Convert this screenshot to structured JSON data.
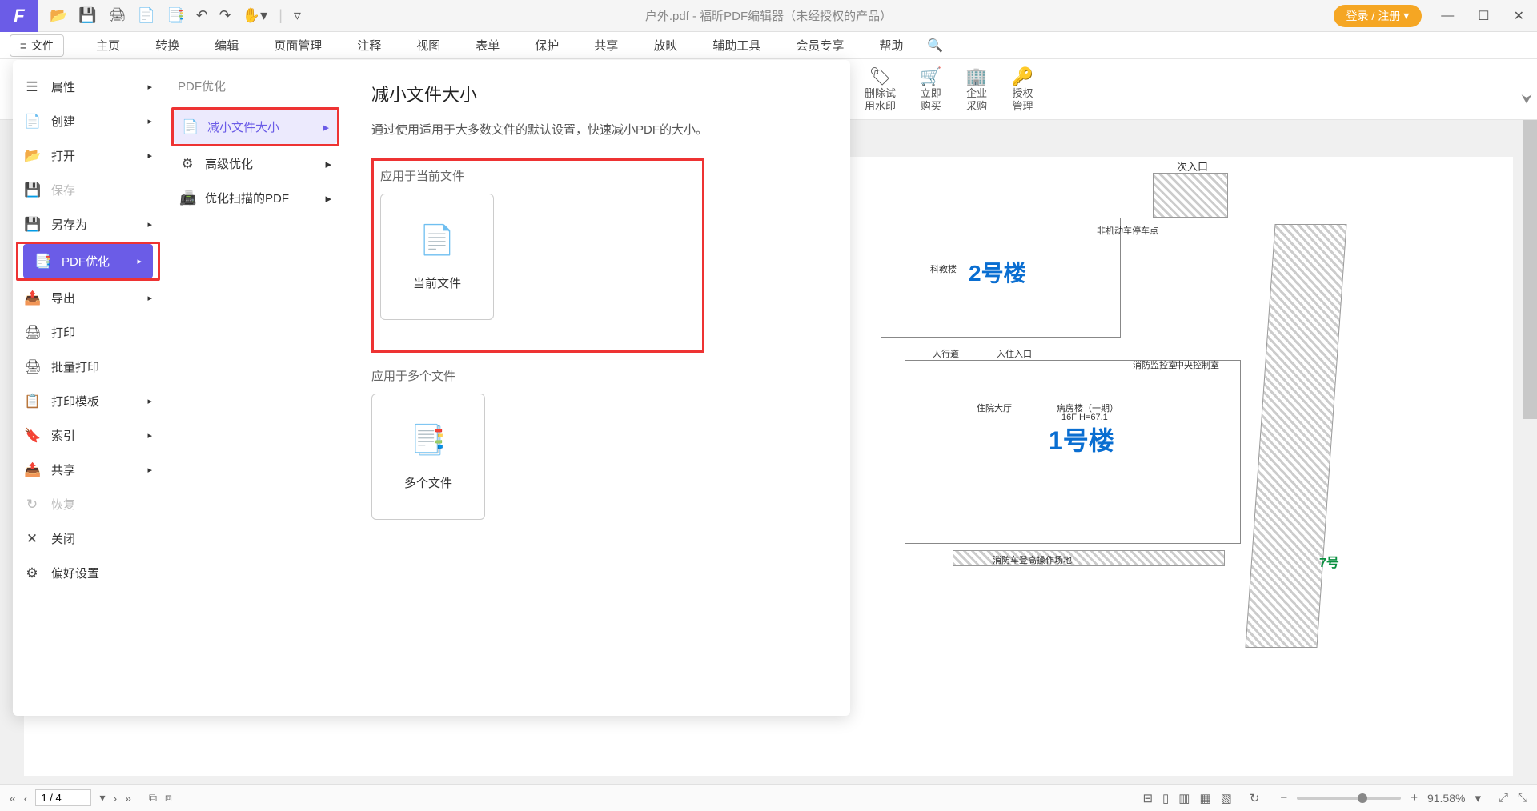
{
  "titlebar": {
    "title": "户外.pdf - 福昕PDF编辑器（未经授权的产品）",
    "login": "登录 / 注册"
  },
  "menubar": {
    "file": "文件",
    "items": [
      "主页",
      "转换",
      "编辑",
      "页面管理",
      "注释",
      "视图",
      "表单",
      "保护",
      "共享",
      "放映",
      "辅助工具",
      "会员专享",
      "帮助"
    ]
  },
  "ribbon": {
    "items": [
      {
        "l1": "删除试",
        "l2": "用水印"
      },
      {
        "l1": "立即",
        "l2": "购买"
      },
      {
        "l1": "企业",
        "l2": "采购"
      },
      {
        "l1": "授权",
        "l2": "管理"
      }
    ]
  },
  "dropdown": {
    "col1": [
      {
        "icon": "☰",
        "label": "属性",
        "arrow": true
      },
      {
        "icon": "📄",
        "label": "创建",
        "arrow": true
      },
      {
        "icon": "📂",
        "label": "打开",
        "arrow": true
      },
      {
        "icon": "💾",
        "label": "保存",
        "arrow": false,
        "disabled": true
      },
      {
        "icon": "💾",
        "label": "另存为",
        "arrow": true
      },
      {
        "icon": "📑",
        "label": "PDF优化",
        "arrow": true,
        "active": true,
        "highlight": true
      },
      {
        "icon": "📤",
        "label": "导出",
        "arrow": true
      },
      {
        "icon": "🖨",
        "label": "打印",
        "arrow": false
      },
      {
        "icon": "🖨",
        "label": "批量打印",
        "arrow": false
      },
      {
        "icon": "📋",
        "label": "打印模板",
        "arrow": true
      },
      {
        "icon": "🔖",
        "label": "索引",
        "arrow": true
      },
      {
        "icon": "📤",
        "label": "共享",
        "arrow": true
      },
      {
        "icon": "↻",
        "label": "恢复",
        "arrow": false,
        "disabled": true
      },
      {
        "icon": "✕",
        "label": "关闭",
        "arrow": false
      },
      {
        "icon": "⚙",
        "label": "偏好设置",
        "arrow": false
      }
    ],
    "col2": {
      "header": "PDF优化",
      "items": [
        {
          "icon": "📄",
          "label": "减小文件大小",
          "arrow": true,
          "selected": true,
          "highlight": true
        },
        {
          "icon": "⚙",
          "label": "高级优化",
          "arrow": true
        },
        {
          "icon": "📠",
          "label": "优化扫描的PDF",
          "arrow": true
        }
      ]
    },
    "col3": {
      "title": "减小文件大小",
      "desc": "通过使用适用于大多数文件的默认设置，快速减小PDF的大小。",
      "section1": "应用于当前文件",
      "card1": "当前文件",
      "section2": "应用于多个文件",
      "card2": "多个文件"
    }
  },
  "map": {
    "entrance": "次入口",
    "b2": "2号楼",
    "b1": "1号楼",
    "kejiao": "科教楼",
    "ward": "病房楼（一期）",
    "floors": "16F H=67.1",
    "lobby": "住院大厅",
    "ruyuan": "入住入口",
    "renxing": "人行道",
    "fire": "消防车登高操作场地",
    "xiaofang": "消防监控室",
    "zhongyang": "中央控制室",
    "parking": "非机动车停车点",
    "b7": "7号"
  },
  "status": {
    "page": "1 / 4",
    "zoom": "91.58%"
  }
}
